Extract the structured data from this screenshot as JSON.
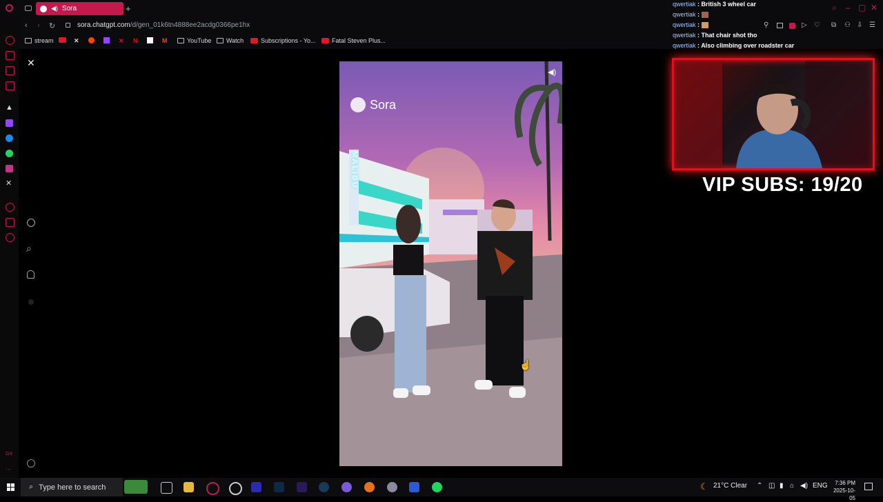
{
  "browser": {
    "tab_title": "Sora",
    "url_domain": "sora.chatgpt.com",
    "url_path": "/d/gen_01k6tn4888ee2acdg0366pe1hx",
    "bookmarks": [
      "stream",
      "YouTube",
      "Watch",
      "Subscriptions - Yo...",
      "Fatal Steven Plus..."
    ]
  },
  "video": {
    "brand": "Sora",
    "sign_text": "MALIBU"
  },
  "chat": [
    {
      "user": "qwertiak",
      "msg": "British 3 wheel car"
    },
    {
      "user": "qwertiak",
      "msg": ""
    },
    {
      "user": "qwertiak",
      "msg": ""
    },
    {
      "user": "qwertiak",
      "msg": "That chair shot tho"
    },
    {
      "user": "qwertiak",
      "msg": "Also climbing over roadster car"
    }
  ],
  "overlay": {
    "vip_text": "VIP SUBS: 19/20"
  },
  "taskbar": {
    "search_placeholder": "Type here to search",
    "weather": "21°C  Clear",
    "language": "ENG",
    "time": "7:36 PM",
    "date": "2025-10-05"
  },
  "colors": {
    "accent": "#c5194e",
    "cam_border": "#e01020"
  }
}
